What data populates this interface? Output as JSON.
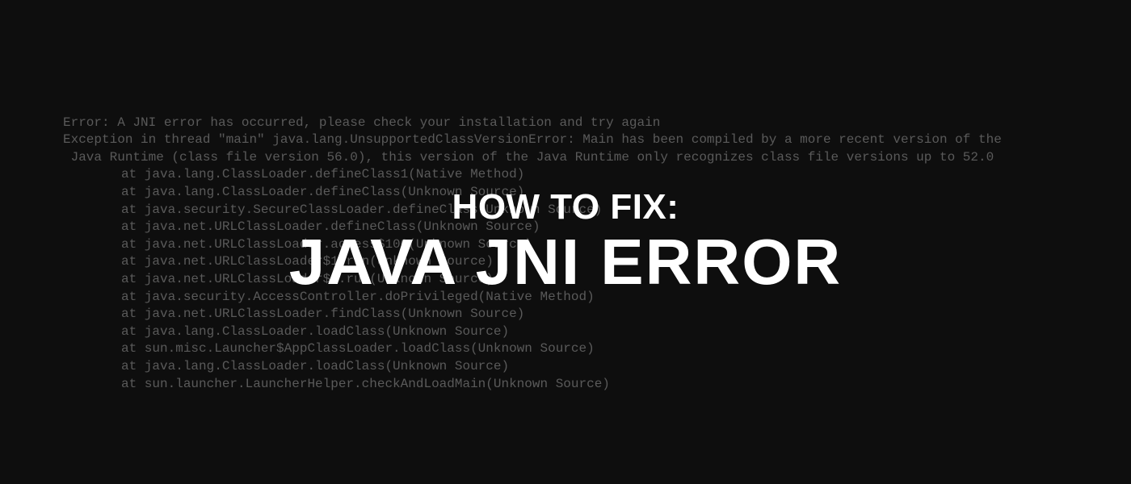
{
  "terminal": {
    "line1": "Error: A JNI error has occurred, please check your installation and try again",
    "line2": "Exception in thread \"main\" java.lang.UnsupportedClassVersionError: Main has been compiled by a more recent version of the",
    "line3": " Java Runtime (class file version 56.0), this version of the Java Runtime only recognizes class file versions up to 52.0",
    "stack": [
      "at java.lang.ClassLoader.defineClass1(Native Method)",
      "at java.lang.ClassLoader.defineClass(Unknown Source)",
      "at java.security.SecureClassLoader.defineClass(Unknown Source)",
      "at java.net.URLClassLoader.defineClass(Unknown Source)",
      "at java.net.URLClassLoader.access$100(Unknown Source)",
      "at java.net.URLClassLoader$1.run(Unknown Source)",
      "at java.net.URLClassLoader$1.run(Unknown Source)",
      "at java.security.AccessController.doPrivileged(Native Method)",
      "at java.net.URLClassLoader.findClass(Unknown Source)",
      "at java.lang.ClassLoader.loadClass(Unknown Source)",
      "at sun.misc.Launcher$AppClassLoader.loadClass(Unknown Source)",
      "at java.lang.ClassLoader.loadClass(Unknown Source)",
      "at sun.launcher.LauncherHelper.checkAndLoadMain(Unknown Source)"
    ]
  },
  "overlay": {
    "subtitle": "HOW TO FIX:",
    "title": "JAVA JNI ERROR"
  }
}
